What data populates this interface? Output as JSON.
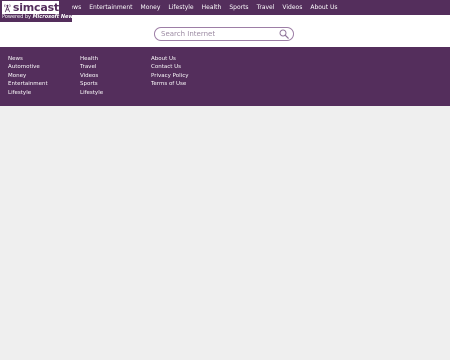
{
  "brand": {
    "name": "simcast",
    "powered_prefix": "Powered by ",
    "powered_brand": "Microsoft News"
  },
  "nav": {
    "items": [
      "News",
      "Entertainment",
      "Money",
      "Lifestyle",
      "Health",
      "Sports",
      "Travel",
      "Videos",
      "About Us"
    ]
  },
  "search": {
    "placeholder": "Search Internet",
    "icon": "search-icon"
  },
  "footer": {
    "col1": [
      "News",
      "Automotive",
      "Money",
      "Entertainment",
      "Lifestyle"
    ],
    "col2": [
      "Health",
      "Travel",
      "Videos",
      "Sports",
      "Lifestyle"
    ],
    "col3": [
      "About Us",
      "Contact Us",
      "Privacy Policy",
      "Terms of Use"
    ]
  },
  "colors": {
    "brand_purple": "#542e5c",
    "page_background": "#efefef"
  }
}
